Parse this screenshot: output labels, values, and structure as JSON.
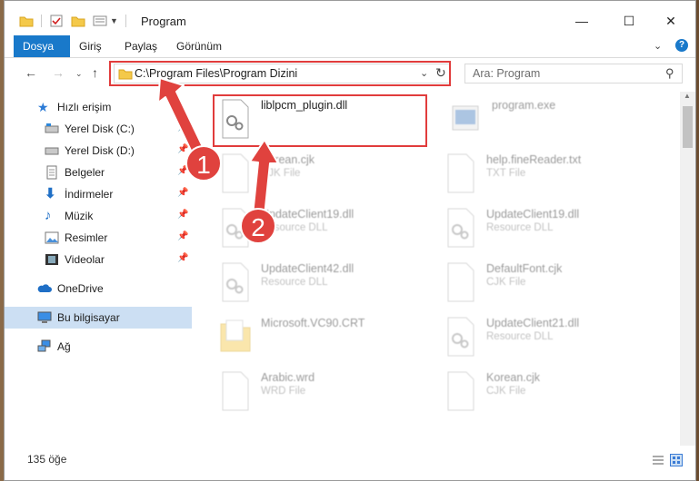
{
  "window": {
    "title": "Program",
    "minimize": "—",
    "maximize": "☐",
    "close": "✕"
  },
  "ribbon": {
    "tabs": [
      "Dosya",
      "Giriş",
      "Paylaş",
      "Görünüm"
    ]
  },
  "address": {
    "path": "C:\\Program Files\\Program Dizini"
  },
  "search": {
    "placeholder": "Ara: Program"
  },
  "sidebar": {
    "items": [
      {
        "label": "Hızlı erişim",
        "icon": "star-icon"
      },
      {
        "label": "Yerel Disk (C:)",
        "icon": "drive-icon",
        "pinned": true
      },
      {
        "label": "Yerel Disk (D:)",
        "icon": "drive-icon",
        "pinned": true
      },
      {
        "label": "Belgeler",
        "icon": "documents-icon",
        "pinned": true
      },
      {
        "label": "İndirmeler",
        "icon": "download-icon",
        "pinned": true
      },
      {
        "label": "Müzik",
        "icon": "music-icon",
        "pinned": true
      },
      {
        "label": "Resimler",
        "icon": "pictures-icon",
        "pinned": true
      },
      {
        "label": "Videolar",
        "icon": "videos-icon",
        "pinned": true
      },
      {
        "label": "OneDrive",
        "icon": "cloud-icon"
      },
      {
        "label": "Bu bilgisayar",
        "icon": "computer-icon",
        "selected": true
      },
      {
        "label": "Ağ",
        "icon": "network-icon"
      }
    ]
  },
  "files": [
    {
      "name": "liblpcm_plugin.dll",
      "type": "",
      "highlighted": true
    },
    {
      "name": "program.exe",
      "type": ""
    },
    {
      "name": "Korean.cjk",
      "type": "CJK File"
    },
    {
      "name": "help.fineReader.txt",
      "type": "TXT File"
    },
    {
      "name": "UpdateClient19.dll",
      "type": "Resource DLL"
    },
    {
      "name": "UpdateClient19.dll",
      "type": "Resource DLL"
    },
    {
      "name": "UpdateClient42.dll",
      "type": "Resource DLL"
    },
    {
      "name": "DefaultFont.cjk",
      "type": "CJK File"
    },
    {
      "name": "Microsoft.VC90.CRT",
      "type": ""
    },
    {
      "name": "UpdateClient21.dll",
      "type": "Resource DLL"
    },
    {
      "name": "Arabic.wrd",
      "type": "WRD File"
    },
    {
      "name": "Korean.cjk",
      "type": "CJK File"
    }
  ],
  "status": {
    "count": "135 öğe"
  },
  "annotations": {
    "badge1": "1",
    "badge2": "2"
  },
  "colors": {
    "accent": "#1979ca",
    "highlight": "#e13c3c",
    "selected": "#ccdff3"
  }
}
